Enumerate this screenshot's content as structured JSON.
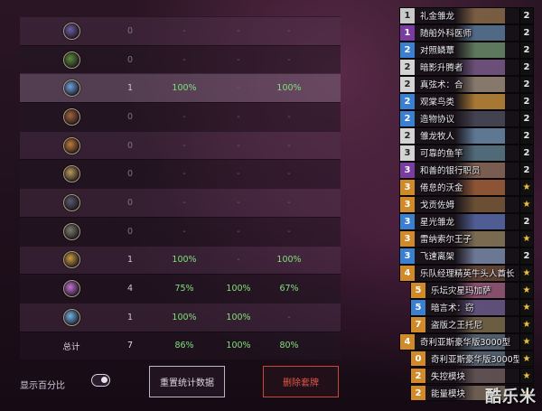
{
  "stats": {
    "rows": [
      {
        "n": "0",
        "p1": "-",
        "p2": "-",
        "p3": "-",
        "icon_color": "#6b5fa0",
        "icon": "warlock-class-icon"
      },
      {
        "n": "0",
        "p1": "-",
        "p2": "-",
        "p3": "-",
        "icon_color": "#5a8a3a",
        "icon": "hunter-class-icon"
      },
      {
        "n": "1",
        "p1": "100%",
        "p2": "-",
        "p3": "100%",
        "icon_color": "#6fa0d8",
        "icon": "mage-class-icon"
      },
      {
        "n": "0",
        "p1": "-",
        "p2": "-",
        "p3": "-",
        "icon_color": "#a0643a",
        "icon": "warrior-class-icon"
      },
      {
        "n": "0",
        "p1": "-",
        "p2": "-",
        "p3": "-",
        "icon_color": "#c07a3a",
        "icon": "druid-class-icon"
      },
      {
        "n": "0",
        "p1": "-",
        "p2": "-",
        "p3": "-",
        "icon_color": "#b89a5a",
        "icon": "paladin-class-icon"
      },
      {
        "n": "0",
        "p1": "-",
        "p2": "-",
        "p3": "-",
        "icon_color": "#5a5a6a",
        "icon": "rogue-class-icon"
      },
      {
        "n": "0",
        "p1": "-",
        "p2": "-",
        "p3": "-",
        "icon_color": "#7a7a6a",
        "icon": "shaman-class-icon"
      },
      {
        "n": "1",
        "p1": "100%",
        "p2": "-",
        "p3": "100%",
        "icon_color": "#c89a40",
        "icon": "paladin-gold-class-icon"
      },
      {
        "n": "4",
        "p1": "75%",
        "p2": "100%",
        "p3": "67%",
        "icon_color": "#c070d0",
        "icon": "demonhunter-class-icon"
      },
      {
        "n": "1",
        "p1": "100%",
        "p2": "100%",
        "p3": "-",
        "icon_color": "#70b0e0",
        "icon": "priest-class-icon"
      }
    ],
    "total": {
      "label": "总计",
      "n": "7",
      "p1": "86%",
      "p2": "100%",
      "p3": "80%"
    }
  },
  "controls": {
    "percent_label": "显示百分比",
    "percent_enabled": true,
    "reset_label": "重置统计数据",
    "delete_label": "删除套牌"
  },
  "deck": {
    "cards": [
      {
        "cost": "1",
        "cls": "c1",
        "name": "礼金雏龙",
        "count": "2",
        "art": "#8a6a4a"
      },
      {
        "cost": "1",
        "cls": "c1p",
        "name": "随船外科医师",
        "count": "2",
        "art": "#5a7a9a"
      },
      {
        "cost": "2",
        "cls": "c2b",
        "name": "对照鳞蕈",
        "count": "2",
        "art": "#6a8a6a"
      },
      {
        "cost": "2",
        "cls": "c2w",
        "name": "暗影升腾者",
        "count": "2",
        "art": "#7a5a8a"
      },
      {
        "cost": "2",
        "cls": "c2w",
        "name": "真弦术：合",
        "count": "2",
        "art": "#9a8a7a"
      },
      {
        "cost": "2",
        "cls": "c2b",
        "name": "观棠鸟类",
        "count": "2",
        "art": "#c08a3a"
      },
      {
        "cost": "2",
        "cls": "c2b",
        "name": "造物协议",
        "count": "2",
        "art": "#4a4a5a"
      },
      {
        "cost": "2",
        "cls": "c2w",
        "name": "雏龙牧人",
        "count": "2",
        "art": "#6a8aaa"
      },
      {
        "cost": "3",
        "cls": "c3w",
        "name": "可靠的鱼竿",
        "count": "2",
        "art": "#5a7a8a"
      },
      {
        "cost": "3",
        "cls": "c3p",
        "name": "和善的银行职员",
        "count": "2",
        "art": "#8a6a5a"
      },
      {
        "cost": "3",
        "cls": "c3o",
        "name": "倦怠的沃金",
        "count": "★",
        "art": "#a0603a"
      },
      {
        "cost": "3",
        "cls": "c3o",
        "name": "戈贡佐姆",
        "count": "★",
        "art": "#7a5a3a"
      },
      {
        "cost": "3",
        "cls": "c3b",
        "name": "星光雏龙",
        "count": "2",
        "art": "#5a6aaa"
      },
      {
        "cost": "3",
        "cls": "c3o",
        "name": "雷纳索尔王子",
        "count": "★",
        "art": "#8a7a5a"
      },
      {
        "cost": "3",
        "cls": "c3b",
        "name": "飞速离架",
        "count": "2",
        "art": "#7a8aaa"
      },
      {
        "cost": "4",
        "cls": "c4o",
        "name": "乐队经理精英牛头人酋长",
        "count": "★",
        "art": "#6a4a3a"
      },
      {
        "cost": "5",
        "cls": "c5o",
        "name": "乐坛灾星玛加萨",
        "count": "★",
        "art": "#9a5a7a"
      },
      {
        "cost": "5",
        "cls": "c5b",
        "name": "暗言术：窃",
        "count": "★",
        "art": "#6a5a8a"
      },
      {
        "cost": "7",
        "cls": "c7o",
        "name": "盗版之王托尼",
        "count": "★",
        "art": "#7a6a4a"
      },
      {
        "cost": "4",
        "cls": "c4o",
        "name": "奇利亚斯豪华版3000型",
        "count": "★",
        "art": "#5a6a7a"
      },
      {
        "cost": "0",
        "cls": "c0o",
        "name": "奇利亚斯豪华版3000型",
        "count": "★",
        "art": "#5a6a7a"
      },
      {
        "cost": "2",
        "cls": "c2o",
        "name": "失控模块",
        "count": "★",
        "art": "#6a5a5a"
      },
      {
        "cost": "2",
        "cls": "c2o",
        "name": "能量模块",
        "count": "★",
        "art": "#7a6a5a"
      }
    ],
    "card_indent": [
      0,
      0,
      0,
      0,
      0,
      0,
      0,
      0,
      0,
      0,
      0,
      0,
      0,
      0,
      0,
      0,
      12,
      12,
      12,
      0,
      12,
      12,
      12
    ]
  },
  "watermark": "酷乐米"
}
